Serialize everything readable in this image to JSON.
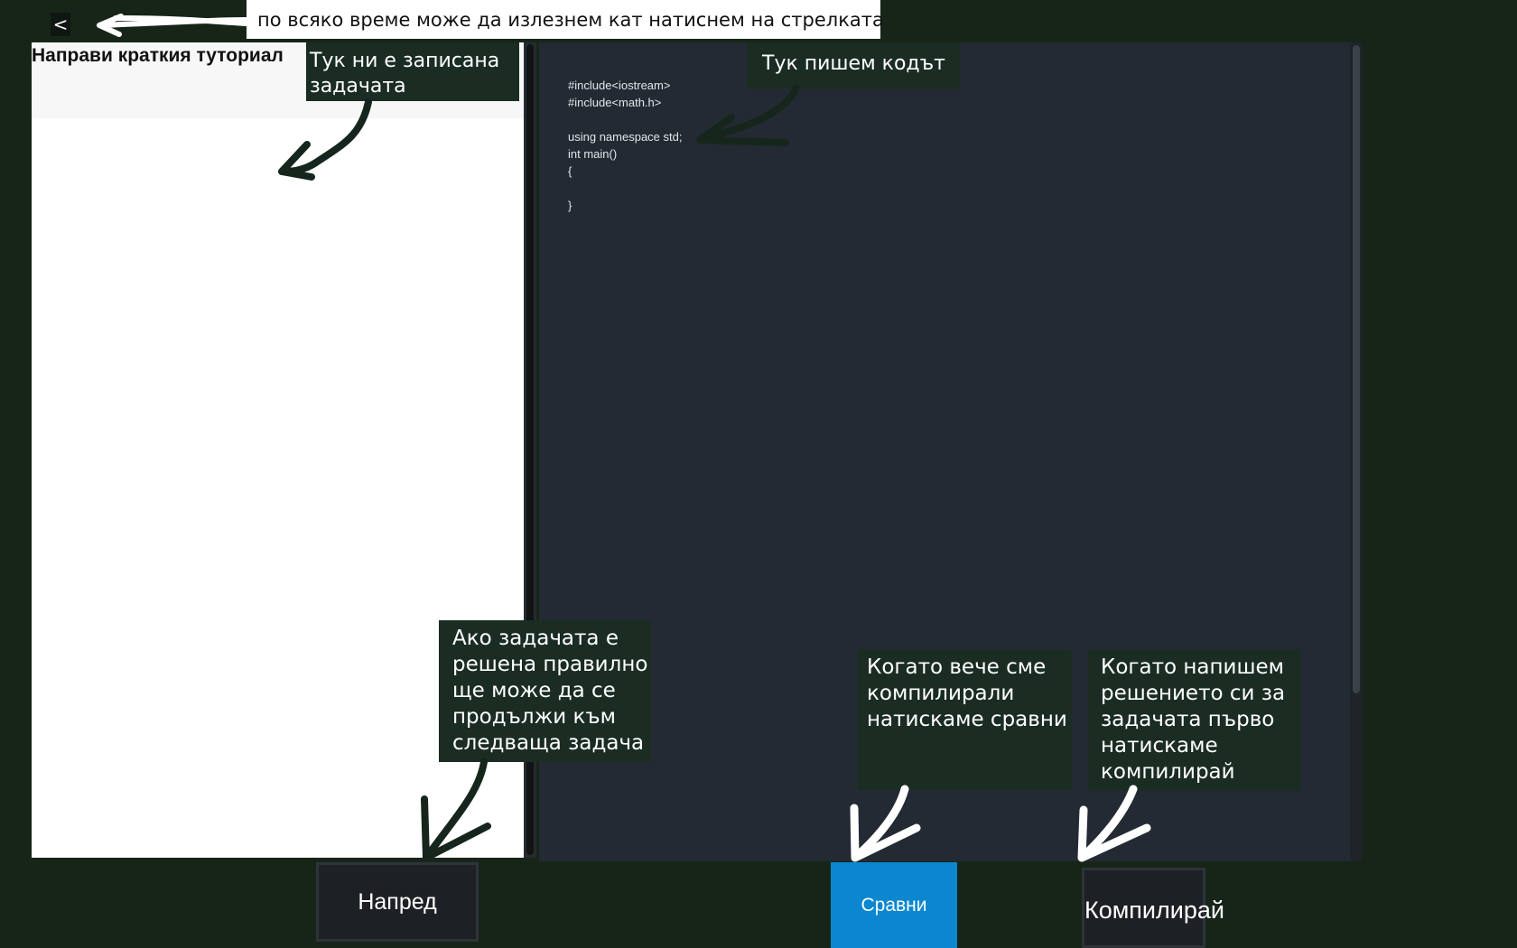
{
  "top_note": "по всяко време може да излезнем кат натиснем на стрелката",
  "back_button": {
    "icon": "chevron-left-icon",
    "glyph": "<"
  },
  "task_panel": {
    "title": "Направи краткия туториал"
  },
  "editor": {
    "code": "#include<iostream>\n#include<math.h>\n\nusing namespace std;\nint main()\n{\n\n}"
  },
  "callouts": {
    "task": [
      "Тук ни е записана",
      "задачата"
    ],
    "code": [
      "Тук пишем кодът"
    ],
    "next": [
      "Ако задачата е",
      "решена правилно",
      "ще може да се",
      "продължи към",
      "следваща задача"
    ],
    "compare": [
      "Когато вече сме",
      "компилирали",
      "натискаме сравни"
    ],
    "compile": [
      "Когато напишем",
      "решението си за",
      "задачата първо",
      "натискаме",
      "компилирай"
    ]
  },
  "buttons": {
    "next_label": "Напред",
    "compare_label": "Сравни",
    "compile_label": "Компилирай"
  },
  "colors": {
    "background": "#172519",
    "editor": "#232a33",
    "compare_button": "#0a87cf",
    "callout": "#1b2d22"
  }
}
